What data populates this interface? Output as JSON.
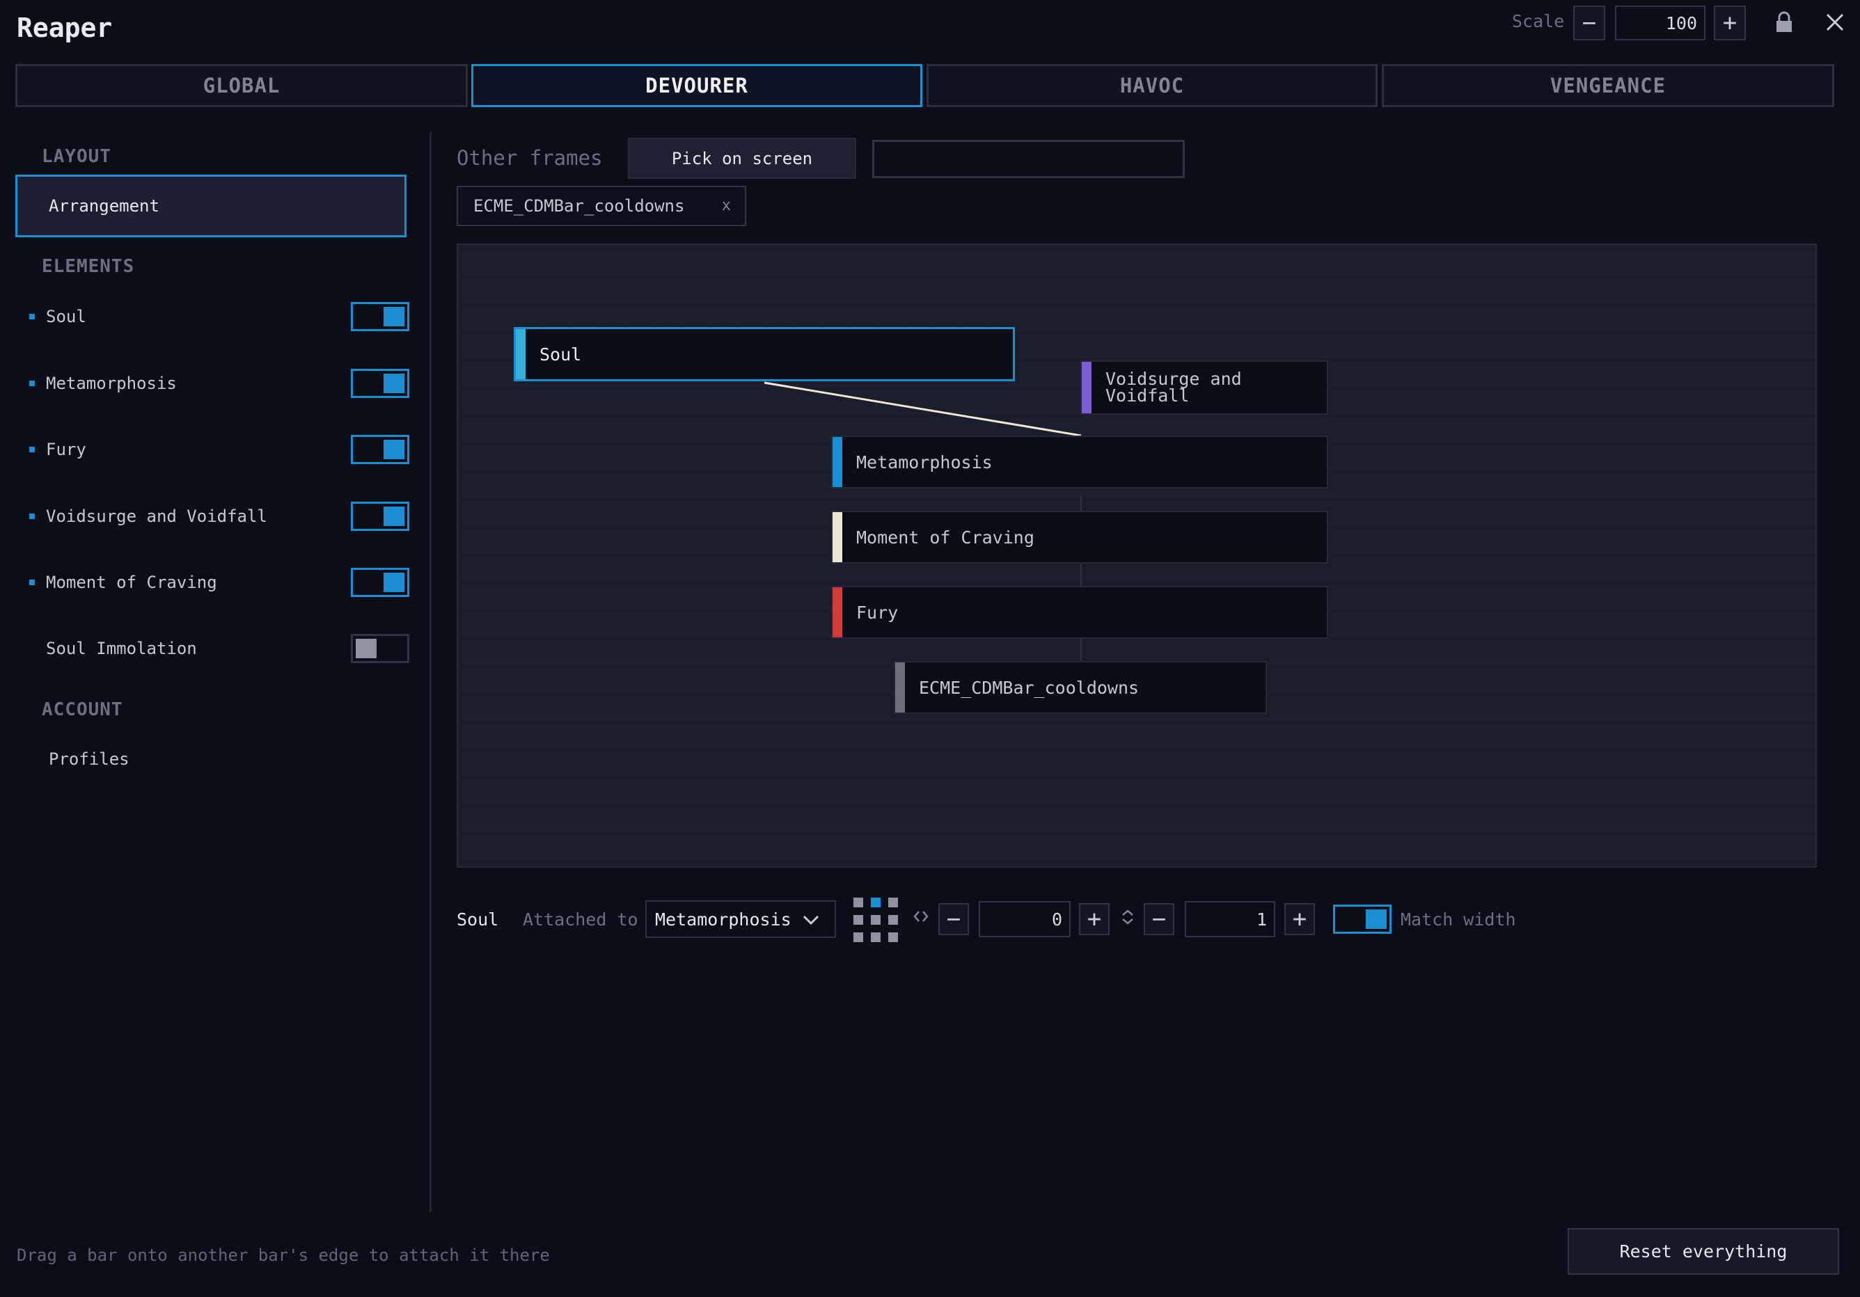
{
  "app": {
    "title": "Reaper"
  },
  "header": {
    "scale_label": "Scale",
    "scale_value": "100",
    "minus_icon": "minus-icon",
    "plus_icon": "plus-icon",
    "lock_icon": "lock-icon",
    "close_icon": "close-icon"
  },
  "tabs": [
    {
      "label": "GLOBAL",
      "active": false
    },
    {
      "label": "DEVOURER",
      "active": true
    },
    {
      "label": "HAVOC",
      "active": false
    },
    {
      "label": "VENGEANCE",
      "active": false
    }
  ],
  "sidebar": {
    "layout_heading": "LAYOUT",
    "arrangement_label": "Arrangement",
    "elements_heading": "ELEMENTS",
    "elements": [
      {
        "label": "Soul",
        "enabled": true
      },
      {
        "label": "Metamorphosis",
        "enabled": true
      },
      {
        "label": "Fury",
        "enabled": true
      },
      {
        "label": "Voidsurge and Voidfall",
        "enabled": true
      },
      {
        "label": "Moment of Craving",
        "enabled": true
      },
      {
        "label": "Soul Immolation",
        "enabled": false
      }
    ],
    "account_heading": "ACCOUNT",
    "profiles_label": "Profiles"
  },
  "other_frames": {
    "label": "Other frames",
    "pick_button": "Pick on screen",
    "input_value": "",
    "chip_label": "ECME_CDMBar_cooldowns",
    "chip_remove": "x"
  },
  "canvas": {
    "bars": [
      {
        "label": "Soul",
        "color": "#3aaed8",
        "selected": true
      },
      {
        "label": "Voidsurge and Voidfall",
        "color": "#7b5cd6",
        "selected": false
      },
      {
        "label": "Metamorphosis",
        "color": "#1a8ed0",
        "selected": false
      },
      {
        "label": "Moment of Craving",
        "color": "#f0e6d6",
        "selected": false
      },
      {
        "label": "Fury",
        "color": "#d33a3a",
        "selected": false
      },
      {
        "label": "ECME_CDMBar_cooldowns",
        "color": "#6b6f7c",
        "selected": false
      }
    ]
  },
  "properties": {
    "selected_name": "Soul",
    "attached_label": "Attached to",
    "attached_value": "Metamorphosis",
    "x_offset": "0",
    "y_offset": "1",
    "match_width_label": "Match width",
    "match_width": true
  },
  "footer": {
    "hint": "Drag a bar onto another bar's edge to attach it there",
    "reset_button": "Reset everything"
  },
  "colors": {
    "accent": "#1a8ed0",
    "background": "#0b0e19"
  }
}
